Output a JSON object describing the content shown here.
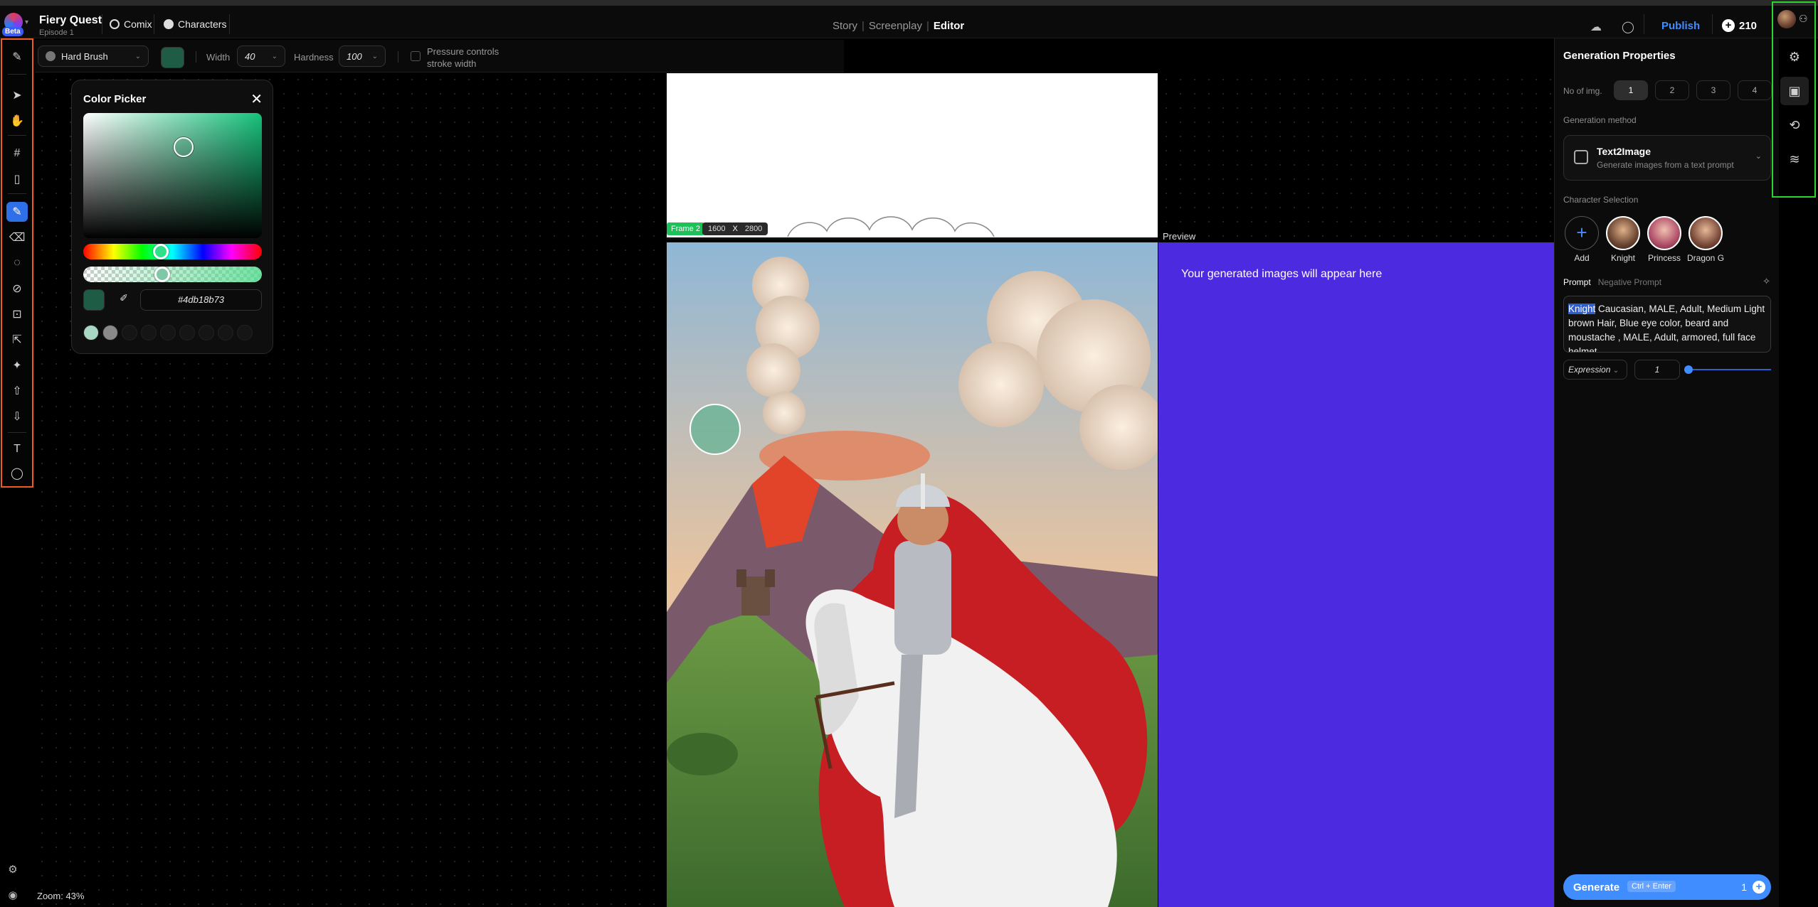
{
  "app": {
    "beta_badge": "Beta",
    "project_title": "Fiery Quest",
    "project_sub": "Episode 1",
    "comix_label": "Comix",
    "characters_label": "Characters"
  },
  "nav": {
    "tabs": [
      "Story",
      "Screenplay",
      "Editor"
    ],
    "active": "Editor"
  },
  "top_right": {
    "publish": "Publish",
    "credits": "210"
  },
  "brush_bar": {
    "brush_name": "Hard Brush",
    "color": "#1f5c45",
    "width_label": "Width",
    "width_value": "40",
    "hardness_label": "Hardness",
    "hardness_value": "100",
    "pressure_label": "Pressure controls stroke width"
  },
  "color_picker": {
    "title": "Color Picker",
    "hex": "#4db18b73",
    "swatches": [
      "#a8d8c4",
      "#8a8a8a",
      "#151515",
      "#151515",
      "#151515",
      "#151515",
      "#151515",
      "#151515",
      "#151515"
    ]
  },
  "canvas": {
    "frame_label": "Frame 2",
    "frame_width": "1600",
    "frame_x": "X",
    "frame_height": "2800",
    "preview_label": "Preview",
    "preview_text": "Your generated images will appear here",
    "zoom": "Zoom:  43%"
  },
  "panel": {
    "title": "Generation Properties",
    "num_label": "No of img.",
    "num_options": [
      "1",
      "2",
      "3",
      "4"
    ],
    "num_selected": "1",
    "method_label": "Generation method",
    "method_name": "Text2Image",
    "method_desc": "Generate images from a text prompt",
    "char_label": "Character Selection",
    "characters": [
      "Add",
      "Knight",
      "Princess",
      "Dragon G"
    ],
    "prompt_tab": "Prompt",
    "negative_tab": "Negative Prompt",
    "prompt_highlight": "Knight",
    "prompt_text": " Caucasian, MALE, Adult, Medium Light brown Hair, Blue eye color, beard and moustache , MALE, Adult, armored, full face helmet",
    "expression_label": "Expression",
    "expression_value": "1",
    "generate_label": "Generate",
    "generate_shortcut": "Ctrl + Enter",
    "generate_count": "1"
  },
  "icons": {
    "left_tools": [
      "brush-icon",
      "pointer-icon",
      "hand-icon",
      "crop-icon",
      "page-icon",
      "pen-icon",
      "eraser-icon",
      "lasso-icon",
      "bandage-icon",
      "magic-edit-icon",
      "export-icon",
      "shape-icon",
      "upload-icon",
      "download-icon",
      "text-icon",
      "speech-bubble-icon"
    ],
    "right_rail": [
      "settings-icon",
      "image-gen-icon",
      "history-icon",
      "layers-icon"
    ]
  },
  "colors": {
    "accent": "#3f8dff",
    "left_toolbar_outline": "#f05a22",
    "right_rail_outline": "#2fd32f",
    "preview_bg": "#4b2ae0",
    "frame_tag": "#1fbf5a"
  }
}
